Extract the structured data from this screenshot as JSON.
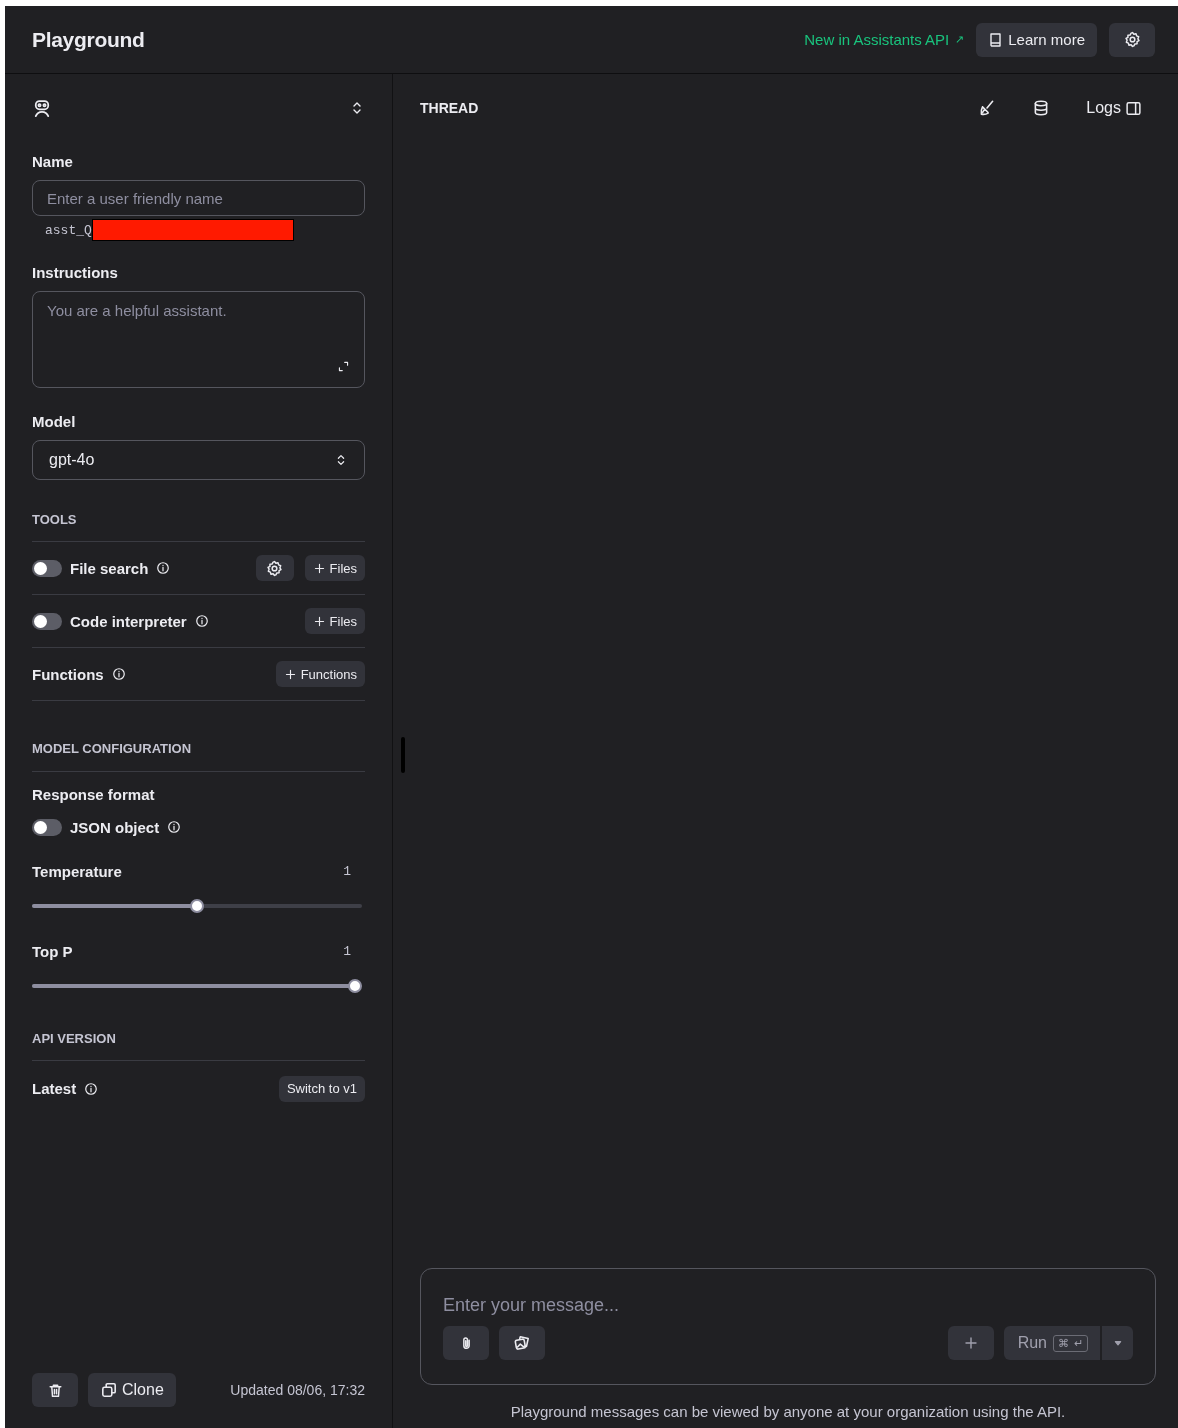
{
  "header": {
    "title": "Playground",
    "announcement": "New in Assistants API",
    "announcement_arrow": "↗",
    "learn_more": "Learn more"
  },
  "sidebar": {
    "name_label": "Name",
    "name_placeholder": "Enter a user friendly name",
    "assistant_id": "asst_Q",
    "instructions_label": "Instructions",
    "instructions_placeholder": "You are a helpful assistant.",
    "model_label": "Model",
    "model_value": "gpt-4o",
    "tools_heading": "TOOLS",
    "tools": [
      {
        "kind": "toggle",
        "label": "File search",
        "on": false,
        "actions": [
          {
            "kind": "settings"
          },
          {
            "kind": "add",
            "label": "Files"
          }
        ]
      },
      {
        "kind": "toggle",
        "label": "Code interpreter",
        "on": false,
        "actions": [
          {
            "kind": "add",
            "label": "Files"
          }
        ]
      },
      {
        "kind": "plain",
        "label": "Functions",
        "actions": [
          {
            "kind": "add",
            "label": "Functions"
          }
        ]
      }
    ],
    "config_heading": "MODEL CONFIGURATION",
    "response_format_label": "Response format",
    "json_object": {
      "label": "JSON object",
      "on": false
    },
    "sliders": [
      {
        "name": "Temperature",
        "reading": "1",
        "level": 0.5
      },
      {
        "name": "Top P",
        "reading": "1",
        "level": 1
      }
    ],
    "api_heading": "API VERSION",
    "api_version": "Latest",
    "switch_button": "Switch to v1",
    "clone_button": "Clone",
    "updated": "Updated 08/06, 17:32"
  },
  "thread": {
    "heading": "THREAD",
    "logs": "Logs",
    "message_placeholder": "Enter your message...",
    "run_button": "Run",
    "run_keys": [
      "⌘",
      "↵"
    ],
    "disclaimer": "Playground messages can be viewed by anyone at your organization using the API."
  }
}
